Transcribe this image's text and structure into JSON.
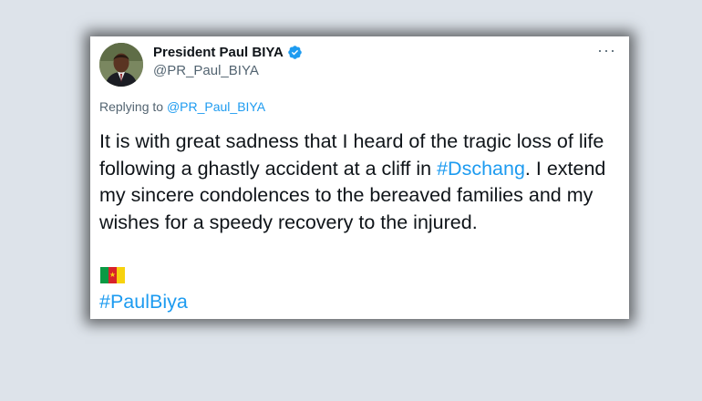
{
  "tweet": {
    "author_name": "President Paul BIYA",
    "author_handle": "@PR_Paul_BIYA",
    "more_label": "···",
    "reply_prefix": "Replying to",
    "reply_handle": "@PR_Paul_BIYA",
    "text_part1": "It is with great sadness that I heard of the tragic loss of life following a ghastly accident at a cliff in ",
    "hashtag1": "#Dschang",
    "text_part2": ". I extend my sincere condolences to the bereaved families and my wishes for a speedy recovery to the injured.",
    "flag_icon": "cameroon-flag-icon",
    "hashtag2": "#PaulBiya"
  },
  "colors": {
    "page_background": "#dde3ea",
    "link_blue": "#1d9bf0",
    "text_primary": "#0f1419",
    "text_secondary": "#536471"
  }
}
